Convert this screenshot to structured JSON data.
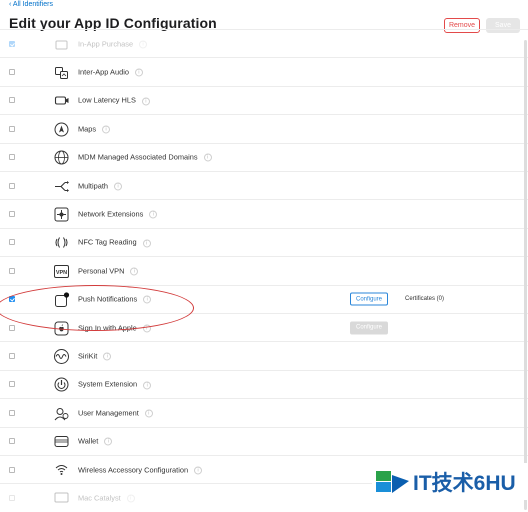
{
  "header": {
    "back_link": "‹ All Identifiers",
    "title": "Edit your App ID Configuration",
    "remove_label": "Remove",
    "save_label": "Save"
  },
  "capabilities": [
    {
      "label": "In-App Purchase",
      "checked": true,
      "icon": "in-app-purchase-icon",
      "faded": true
    },
    {
      "label": "Inter-App Audio",
      "checked": false,
      "icon": "inter-app-audio-icon"
    },
    {
      "label": "Low Latency HLS",
      "checked": false,
      "icon": "low-latency-hls-icon"
    },
    {
      "label": "Maps",
      "checked": false,
      "icon": "maps-icon"
    },
    {
      "label": "MDM Managed Associated Domains",
      "checked": false,
      "icon": "mdm-domains-icon"
    },
    {
      "label": "Multipath",
      "checked": false,
      "icon": "multipath-icon"
    },
    {
      "label": "Network Extensions",
      "checked": false,
      "icon": "network-extensions-icon"
    },
    {
      "label": "NFC Tag Reading",
      "checked": false,
      "icon": "nfc-icon"
    },
    {
      "label": "Personal VPN",
      "checked": false,
      "icon": "vpn-icon"
    },
    {
      "label": "Push Notifications",
      "checked": true,
      "icon": "push-notifications-icon",
      "configure": "Configure",
      "certificates": "Certificates (0)"
    },
    {
      "label": "Sign In with Apple",
      "checked": false,
      "icon": "sign-in-with-apple-icon",
      "configure_disabled": "Configure"
    },
    {
      "label": "SiriKit",
      "checked": false,
      "icon": "sirikit-icon"
    },
    {
      "label": "System Extension",
      "checked": false,
      "icon": "system-extension-icon"
    },
    {
      "label": "User Management",
      "checked": false,
      "icon": "user-management-icon"
    },
    {
      "label": "Wallet",
      "checked": false,
      "icon": "wallet-icon"
    },
    {
      "label": "Wireless Accessory Configuration",
      "checked": false,
      "icon": "wireless-accessory-icon"
    },
    {
      "label": "Mac Catalyst",
      "checked": false,
      "icon": "mac-catalyst-icon",
      "faded": true
    }
  ],
  "watermark": {
    "text": "IT技术6HU"
  },
  "colors": {
    "accent": "#2a86d9",
    "remove": "#e34a4a",
    "highlight_ellipse": "#d23b3b"
  }
}
